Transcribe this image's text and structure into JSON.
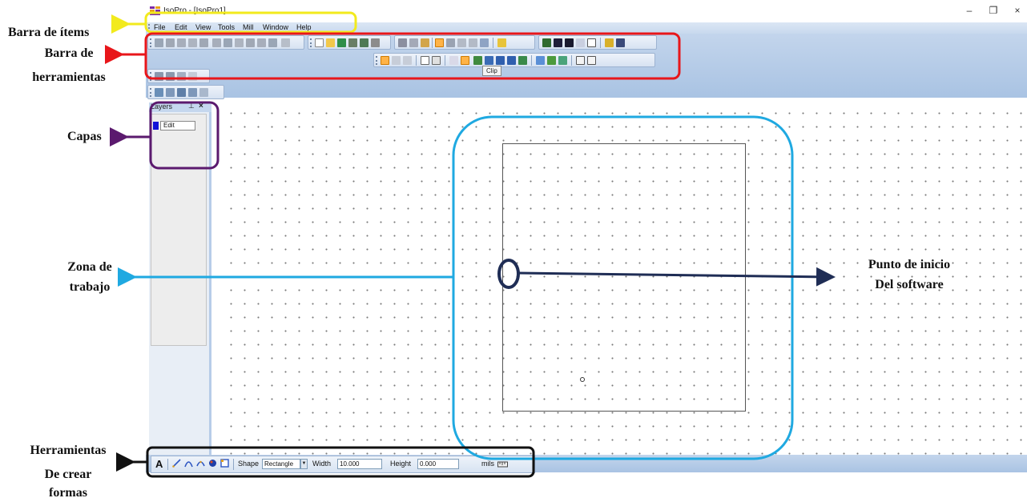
{
  "window": {
    "title": "IsoPro - [IsoPro1]",
    "controls": {
      "minimize": "–",
      "restore": "❐",
      "close": "×"
    }
  },
  "menu": [
    "File",
    "Edit",
    "View",
    "Tools",
    "Mill",
    "Window",
    "Help"
  ],
  "tooltip": "Clip",
  "layers_panel": {
    "title": "Layers",
    "pin": "⊥",
    "close": "×",
    "layers": [
      {
        "name": "Edit",
        "color": "#1212d8"
      }
    ]
  },
  "shape_toolbar": {
    "text_tool": "A",
    "shape_label": "Shape",
    "shape_value": "Rectangle",
    "width_label": "Width",
    "width_value": "10.000",
    "height_label": "Height",
    "height_value": "0.000",
    "units": "mils"
  },
  "annotations": {
    "items_bar": "Barra de ítems",
    "toolbar_line1": "Barra de",
    "toolbar_line2": "herramientas",
    "layers": "Capas",
    "work_zone_line1": "Zona de",
    "work_zone_line2": "trabajo",
    "origin_line1": "Punto de inicio",
    "origin_line2": "Del software",
    "shape_tools_line1": "Herramientas",
    "shape_tools_line2": "De crear",
    "shape_tools_line3": "formas"
  },
  "colors": {
    "items_bar_outline": "#f2ea1d",
    "toolbar_outline": "#e8161a",
    "layers_outline": "#5b1a6e",
    "work_zone_outline": "#1fa9e1",
    "origin_outline": "#1f2d55",
    "shape_tools_outline": "#111111"
  }
}
